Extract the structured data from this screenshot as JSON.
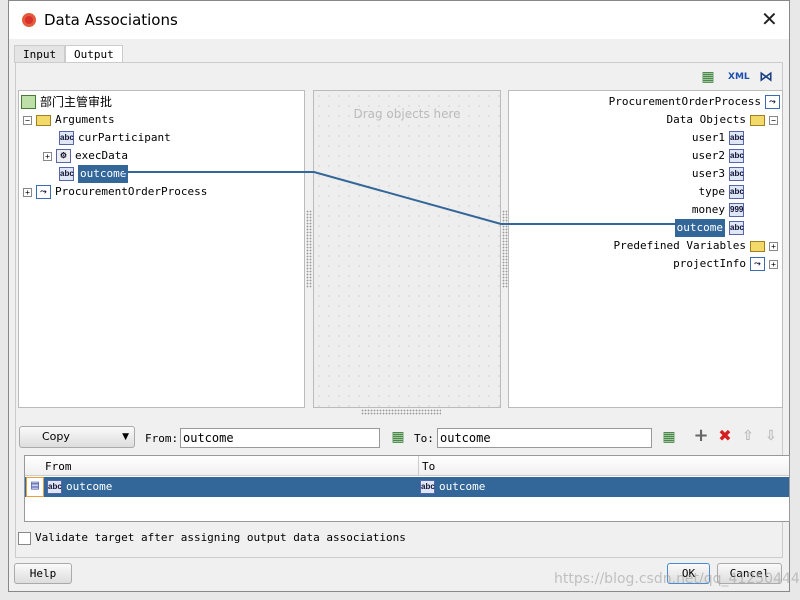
{
  "window": {
    "title": "Data Associations",
    "close_icon": "close-icon"
  },
  "tabs": [
    {
      "label": "Input",
      "active": false
    },
    {
      "label": "Output",
      "active": true
    }
  ],
  "source_tree": {
    "root": "部门主管审批",
    "arguments": "Arguments",
    "items": [
      "curParticipant",
      "execData",
      "outcome"
    ],
    "process": "ProcurementOrderProcess"
  },
  "middle": {
    "placeholder": "Drag objects here"
  },
  "target_tree": {
    "root": "ProcurementOrderProcess",
    "data_objects": "Data Objects",
    "items": [
      {
        "label": "user1",
        "type": "abc"
      },
      {
        "label": "user2",
        "type": "abc"
      },
      {
        "label": "user3",
        "type": "abc"
      },
      {
        "label": "type",
        "type": "abc"
      },
      {
        "label": "money",
        "type": "999"
      },
      {
        "label": "outcome",
        "type": "abc"
      }
    ],
    "predefined": "Predefined Variables",
    "project_info": "projectInfo"
  },
  "mapping": {
    "mode": "Copy",
    "from_label": "From:",
    "from_value": "outcome",
    "to_label": "To:",
    "to_value": "outcome"
  },
  "table": {
    "columns": [
      "From",
      "To"
    ],
    "rows": [
      {
        "from": "outcome",
        "to": "outcome"
      }
    ]
  },
  "validate_label": "Validate target after assigning output data associations",
  "buttons": {
    "help": "Help",
    "ok": "OK",
    "cancel": "Cancel"
  },
  "watermark": "https://blog.csdn.net/qq_41250444",
  "colors": {
    "selection": "#336699",
    "link_line": "#336699"
  }
}
